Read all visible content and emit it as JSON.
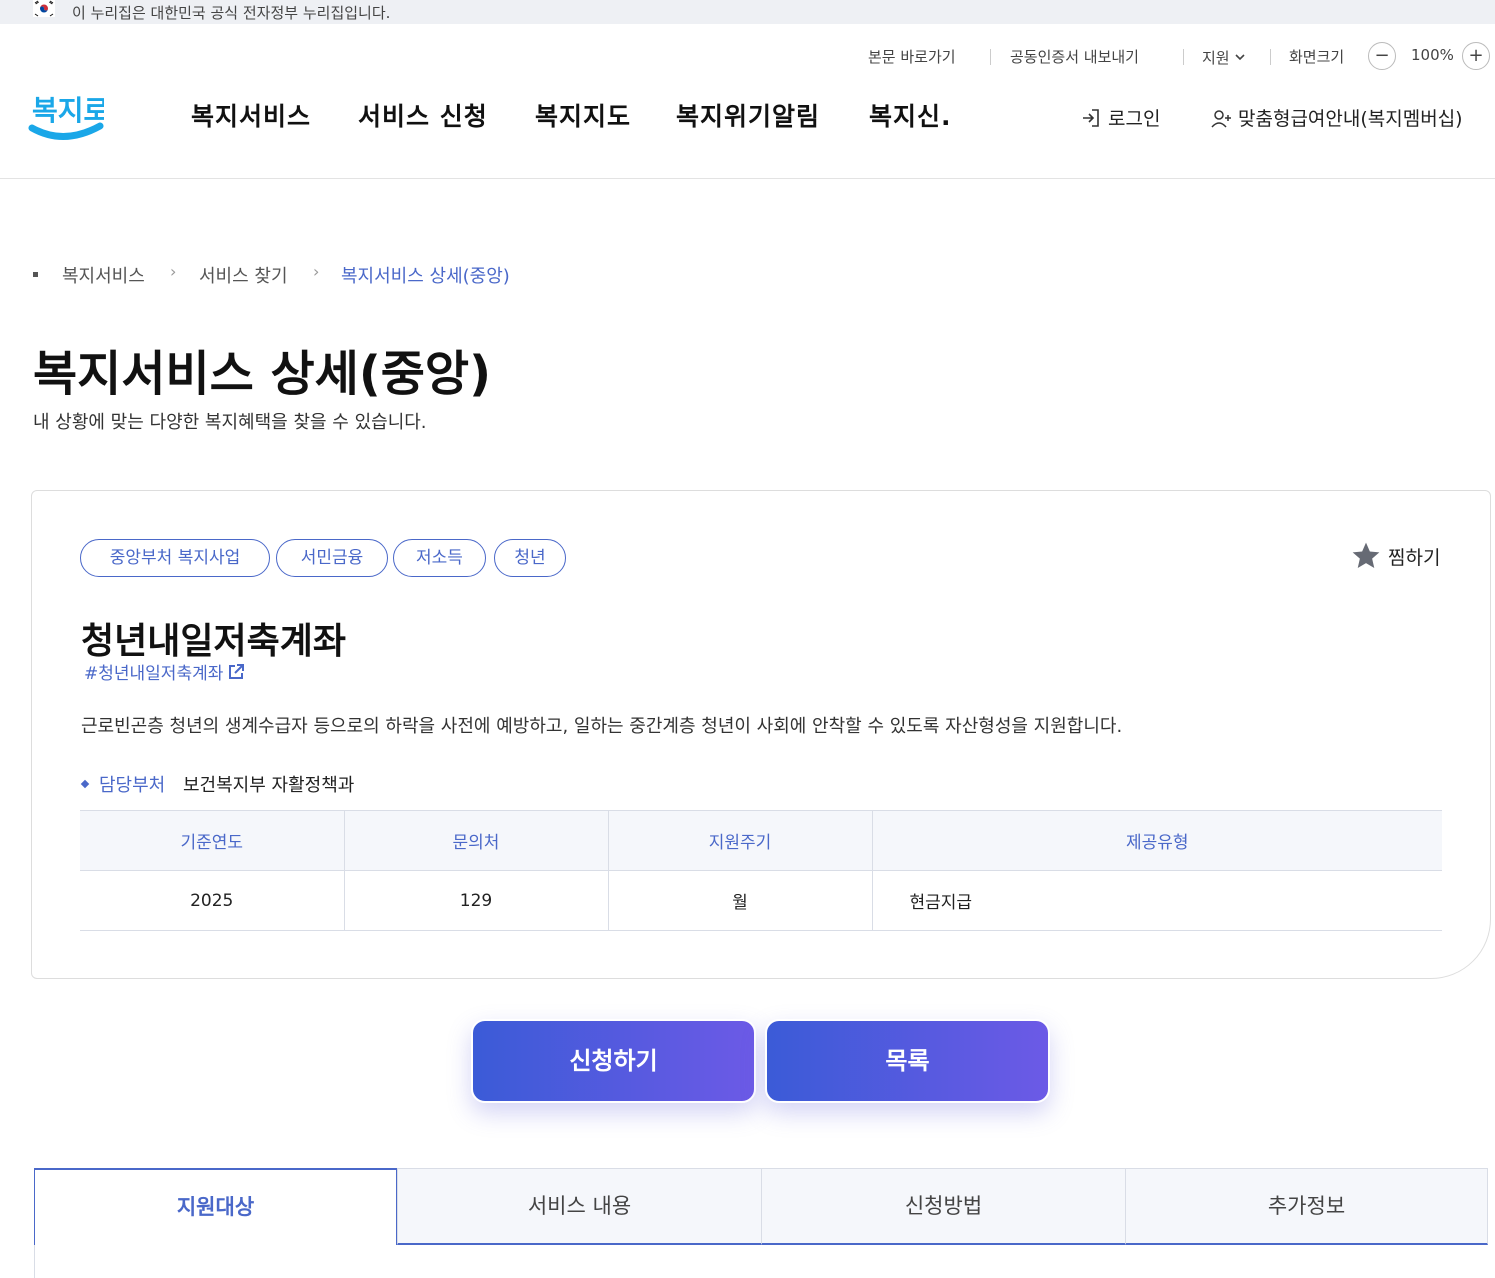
{
  "gov_banner": {
    "text": "이 누리집은 대한민국 공식 전자정부 누리집입니다."
  },
  "utility": {
    "skip": "본문 바로가기",
    "cert": "공동인증서 내보내기",
    "lang": "지원",
    "zoom_label": "화면크기",
    "zoom_minus": "−",
    "zoom_value": "100%",
    "zoom_plus": "+"
  },
  "logo": {
    "text": "복지로"
  },
  "gnb": [
    "복지서비스",
    "서비스 신청",
    "복지지도",
    "복지위기알림",
    "복지신."
  ],
  "header": {
    "login": "로그인",
    "membership": "맞춤형급여안내(복지멤버십)"
  },
  "breadcrumb": [
    "복지서비스",
    "서비스 찾기",
    "복지서비스 상세(중앙)"
  ],
  "page": {
    "title": "복지서비스 상세(중앙)",
    "subtitle": "내 상황에 맞는 다양한 복지혜택을 찾을 수 있습니다."
  },
  "service": {
    "tags": [
      "중앙부처 복지사업",
      "서민금융",
      "저소득",
      "청년"
    ],
    "favorite": "찜하기",
    "title": "청년내일저축계좌",
    "hashtag": "#청년내일저축계좌",
    "description": "근로빈곤층 청년의 생계수급자 등으로의 하락을 사전에 예방하고, 일하는 중간계층 청년이 사회에 안착할 수 있도록 자산형성을 지원합니다.",
    "dept_label": "담당부처",
    "dept_value": "보건복지부 자활정책과",
    "table": {
      "headers": [
        "기준연도",
        "문의처",
        "지원주기",
        "제공유형"
      ],
      "row": [
        "2025",
        "129",
        "월",
        "현금지급"
      ]
    }
  },
  "actions": {
    "apply": "신청하기",
    "list": "목록"
  },
  "tabs": [
    "지원대상",
    "서비스 내용",
    "신청방법",
    "추가정보"
  ],
  "colors": {
    "accent": "#4a68c9",
    "button_start": "#3b5bd7",
    "button_end": "#6c5ae6",
    "logo_blue": "#1aa7e8"
  }
}
